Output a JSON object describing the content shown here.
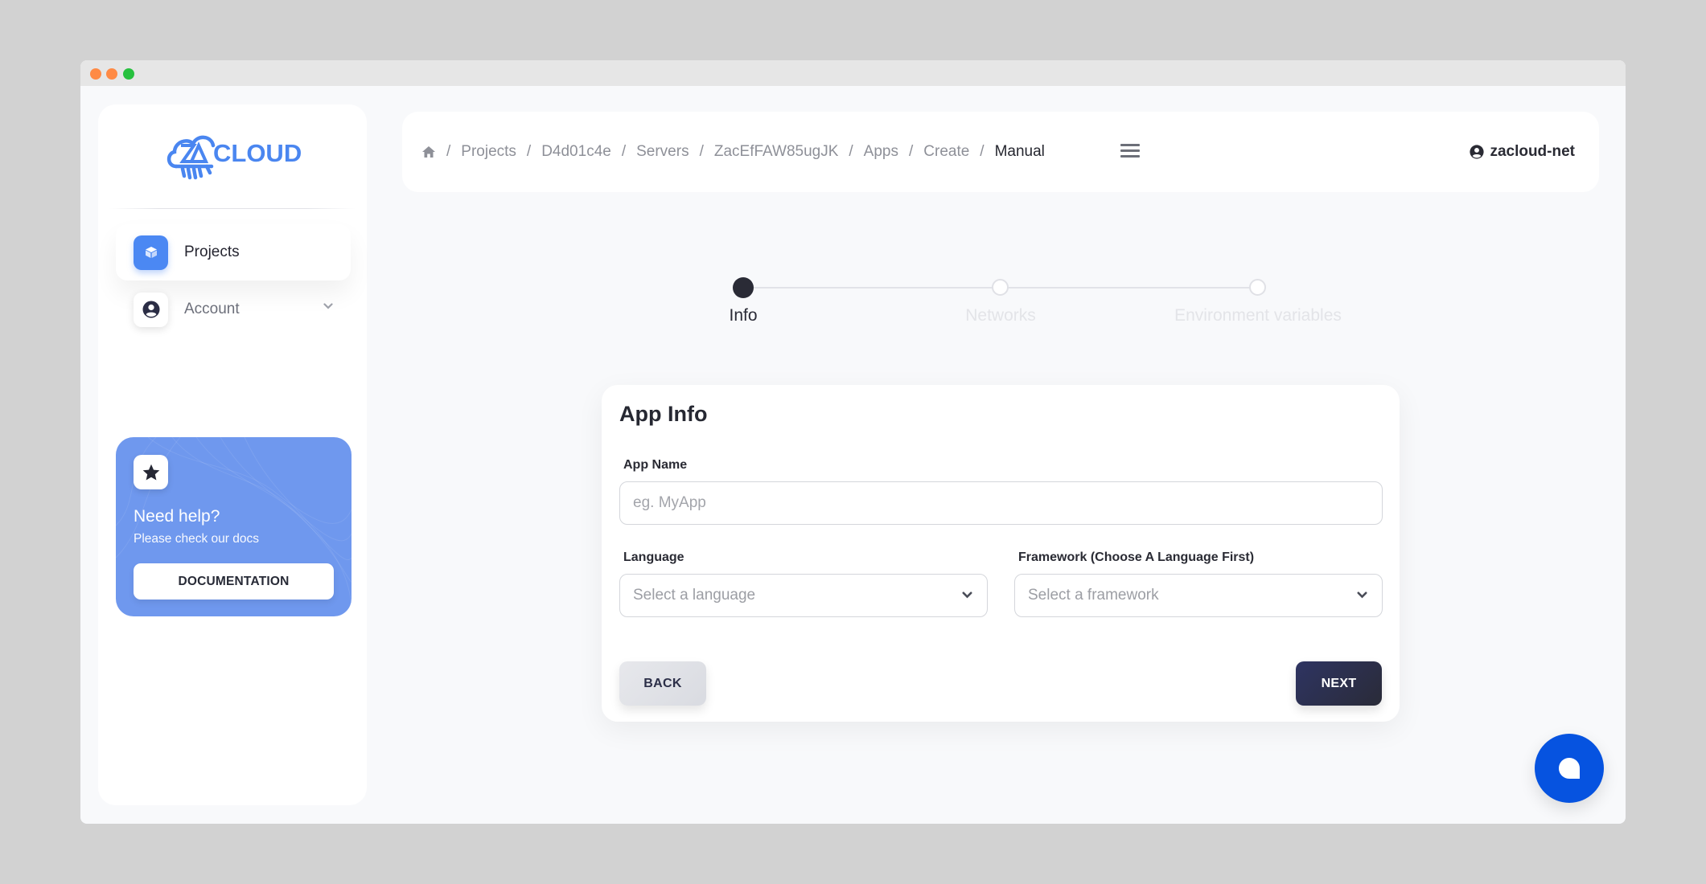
{
  "window": {
    "traffic_lights": [
      "close",
      "minimize",
      "maximize"
    ]
  },
  "brand": {
    "logo_text": "CLOUD",
    "logo_mark": "ZA",
    "color": "#4a86f0"
  },
  "sidebar": {
    "items": [
      {
        "label": "Projects",
        "icon": "cube-icon",
        "active": true
      },
      {
        "label": "Account",
        "icon": "user-circle-icon",
        "active": false,
        "expandable": true
      }
    ],
    "help_card": {
      "icon": "star-icon",
      "title": "Need help?",
      "subtitle": "Please check our docs",
      "button_label": "DOCUMENTATION"
    }
  },
  "header": {
    "breadcrumb": [
      {
        "label": "Projects"
      },
      {
        "label": "D4d01c4e"
      },
      {
        "label": "Servers"
      },
      {
        "label": "ZacEfFAW85ugJK"
      },
      {
        "label": "Apps"
      },
      {
        "label": "Create"
      },
      {
        "label": "Manual",
        "current": true
      }
    ],
    "separator": "/",
    "home_icon": "home-icon",
    "menu_icon": "hamburger-icon",
    "user": {
      "icon": "user-circle-icon",
      "name": "zacloud-net"
    }
  },
  "stepper": {
    "current_step": 1,
    "total_steps": 3,
    "steps": [
      {
        "label": "Info",
        "state": "active"
      },
      {
        "label": "Networks",
        "state": "inactive"
      },
      {
        "label": "Environment variables",
        "state": "inactive"
      }
    ]
  },
  "form": {
    "title": "App Info",
    "app_name": {
      "label": "App Name",
      "value": "",
      "placeholder": "eg. MyApp"
    },
    "language": {
      "label": "Language",
      "value": "",
      "placeholder": "Select a language"
    },
    "framework": {
      "label": "Framework (Choose A Language First)",
      "value": "",
      "placeholder": "Select a framework"
    },
    "back_label": "BACK",
    "next_label": "NEXT"
  },
  "chat": {
    "icon": "chat-bubble-icon",
    "color": "#0653e0"
  }
}
